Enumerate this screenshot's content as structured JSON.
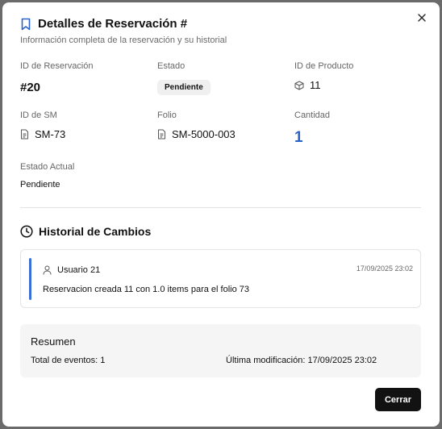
{
  "dialog": {
    "title": "Detalles de Reservación #",
    "subtitle": "Información completa de la reservación y su historial",
    "close_icon": "close-icon",
    "title_icon": "bookmark-icon"
  },
  "fields": {
    "reservation_id": {
      "label": "ID de Reservación",
      "value": "#20"
    },
    "status": {
      "label": "Estado",
      "value": "Pendiente"
    },
    "product_id": {
      "label": "ID de Producto",
      "value": "11",
      "icon": "box-icon"
    },
    "sm_id": {
      "label": "ID de SM",
      "value": "SM-73",
      "icon": "document-icon"
    },
    "folio": {
      "label": "Folio",
      "value": "SM-5000-003",
      "icon": "document-icon"
    },
    "quantity": {
      "label": "Cantidad",
      "value": "1"
    },
    "current_status": {
      "label": "Estado Actual",
      "value": "Pendiente"
    }
  },
  "history": {
    "title": "Historial de Cambios",
    "icon": "clock-icon",
    "entries": [
      {
        "user": "Usuario 21",
        "date": "17/09/2025 23:02",
        "description": "Reservacion creada 11 con 1.0 items para el folio 73",
        "icon": "user-icon"
      }
    ]
  },
  "summary": {
    "title": "Resumen",
    "total_events": "Total de eventos: 1",
    "last_modified": "Última modificación: 17/09/2025 23:02"
  },
  "footer": {
    "close_label": "Cerrar"
  },
  "colors": {
    "accent": "#3b6fd8",
    "quantity": "#2a62c9",
    "button_bg": "#121212"
  }
}
